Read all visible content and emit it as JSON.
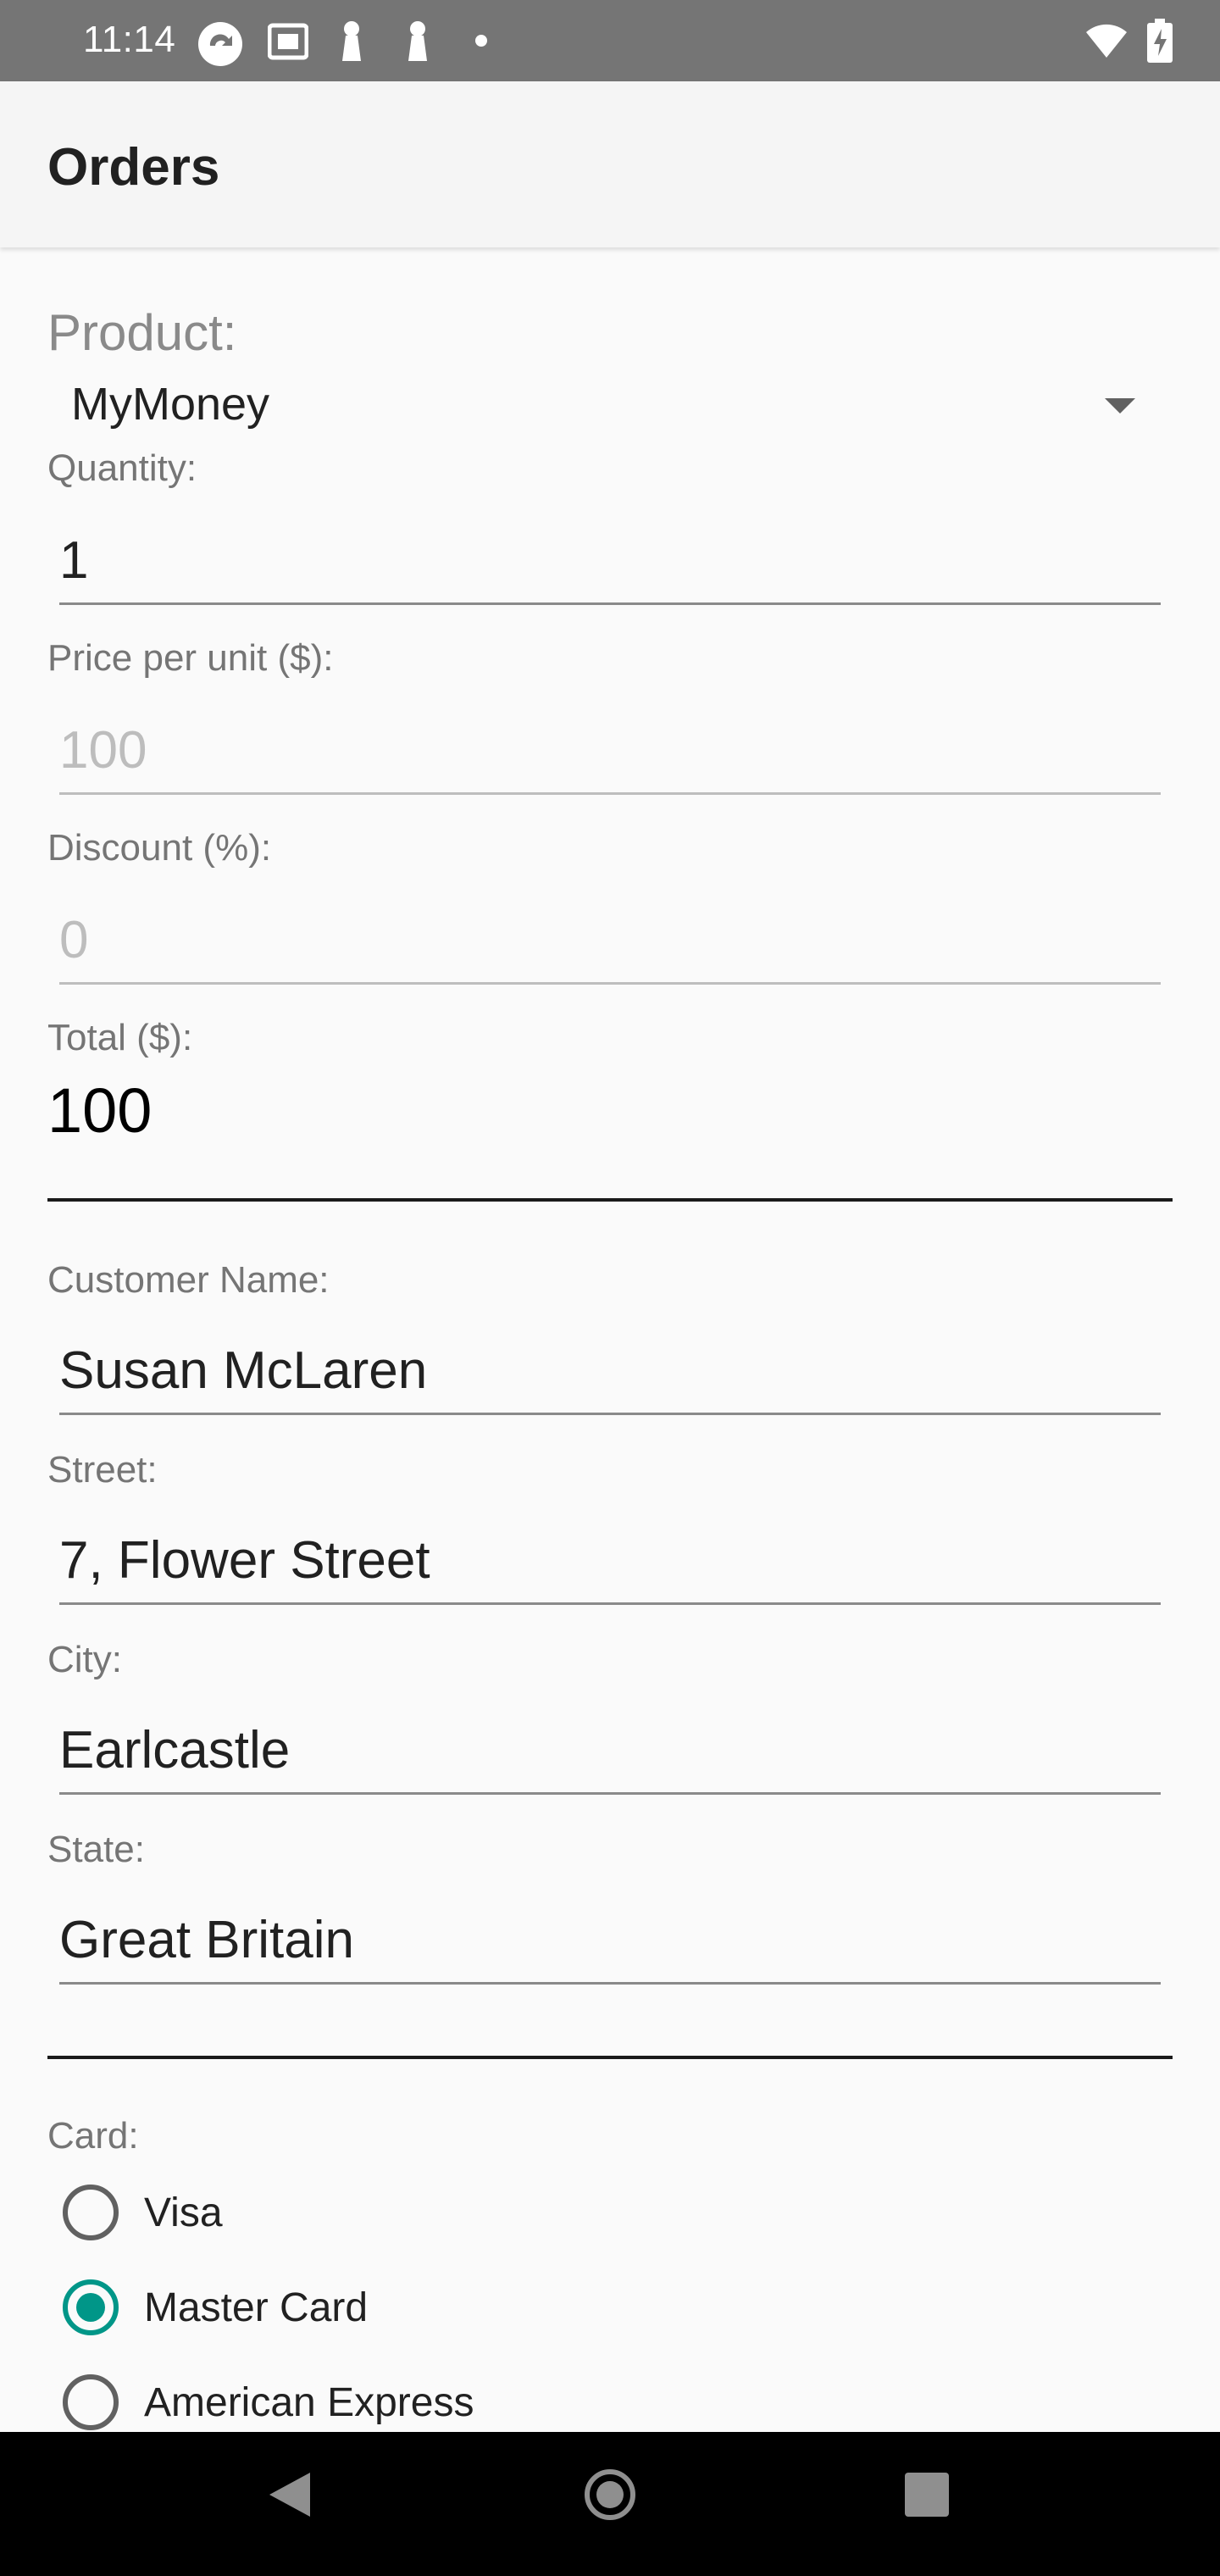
{
  "status_bar": {
    "time": "11:14",
    "left_icons": [
      "sync-icon",
      "storage-icon",
      "mic-icon",
      "mic-icon",
      "dot-icon"
    ],
    "right_icons": [
      "wifi-icon",
      "battery-charging-icon"
    ]
  },
  "app_bar": {
    "title": "Orders"
  },
  "form": {
    "product_label": "Product:",
    "product_value": "MyMoney",
    "quantity_label": "Quantity:",
    "quantity_value": "1",
    "price_label": "Price per unit ($):",
    "price_value": "100",
    "discount_label": "Discount (%):",
    "discount_value": "0",
    "total_label": "Total ($):",
    "total_value": "100",
    "customer_label": "Customer Name:",
    "customer_value": "Susan McLaren",
    "street_label": "Street:",
    "street_value": "7, Flower Street",
    "city_label": "City:",
    "city_value": "Earlcastle",
    "state_label": "State:",
    "state_value": "Great Britain",
    "card_label": "Card:",
    "cards": [
      {
        "label": "Visa",
        "checked": false
      },
      {
        "label": "Master Card",
        "checked": true
      },
      {
        "label": "American Express",
        "checked": false
      }
    ]
  },
  "colors": {
    "accent": "#009688",
    "status_bar": "#757575",
    "app_bar": "#f5f5f5",
    "background": "#fafafa"
  },
  "nav_bar": {
    "icons": [
      "back-icon",
      "home-icon",
      "recents-icon"
    ]
  }
}
